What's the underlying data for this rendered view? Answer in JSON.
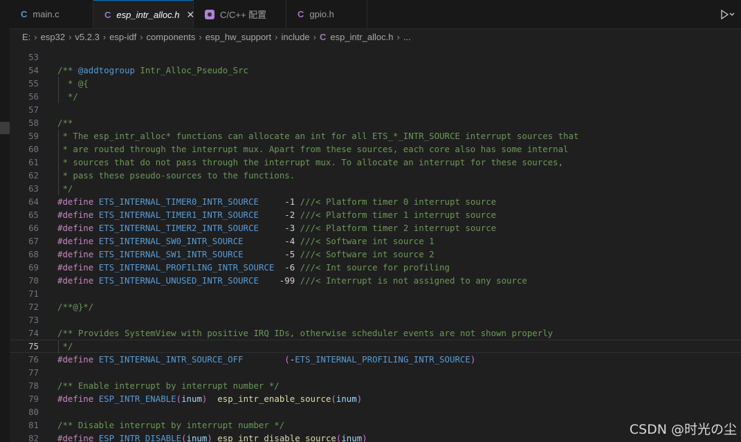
{
  "tabs": [
    {
      "icon": "C",
      "label": "main.c"
    },
    {
      "icon": "C",
      "label": "esp_intr_alloc.h",
      "close": "✕"
    },
    {
      "label": "C/C++ 配置"
    },
    {
      "icon": "C",
      "label": "gpio.h"
    }
  ],
  "breadcrumb": {
    "items": [
      "E:",
      "esp32",
      "v5.2.3",
      "esp-idf",
      "components",
      "esp_hw_support",
      "include"
    ],
    "file_icon": "C",
    "file": "esp_intr_alloc.h",
    "more": "...",
    "separator": "›"
  },
  "editor": {
    "lines": [
      {
        "n": "53",
        "parts": []
      },
      {
        "n": "54",
        "parts": [
          [
            "cm",
            "/** "
          ],
          [
            "tag",
            "@addtogroup"
          ],
          [
            "cm",
            " Intr_Alloc_Pseudo_Src"
          ]
        ]
      },
      {
        "n": "55",
        "parts": [
          [
            "cm",
            "  * @{"
          ]
        ]
      },
      {
        "n": "56",
        "parts": [
          [
            "cm",
            "  */"
          ]
        ]
      },
      {
        "n": "57",
        "parts": []
      },
      {
        "n": "58",
        "parts": [
          [
            "cm",
            "/**"
          ]
        ]
      },
      {
        "n": "59",
        "parts": [
          [
            "cm",
            " * The esp_intr_alloc* functions can allocate an int for all ETS_*_INTR_SOURCE interrupt sources that"
          ]
        ]
      },
      {
        "n": "60",
        "parts": [
          [
            "cm",
            " * are routed through the interrupt mux. Apart from these sources, each core also has some internal"
          ]
        ]
      },
      {
        "n": "61",
        "parts": [
          [
            "cm",
            " * sources that do not pass through the interrupt mux. To allocate an interrupt for these sources,"
          ]
        ]
      },
      {
        "n": "62",
        "parts": [
          [
            "cm",
            " * pass these pseudo-sources to the functions."
          ]
        ]
      },
      {
        "n": "63",
        "parts": [
          [
            "cm",
            " */"
          ]
        ]
      },
      {
        "n": "64",
        "parts": [
          [
            "pp",
            "#define"
          ],
          [
            "pun",
            " "
          ],
          [
            "mac",
            "ETS_INTERNAL_TIMER0_INTR_SOURCE"
          ],
          [
            "pun",
            "     "
          ],
          [
            "num",
            "-1"
          ],
          [
            "pun",
            " "
          ],
          [
            "cm",
            "///< Platform timer 0 interrupt source"
          ]
        ]
      },
      {
        "n": "65",
        "parts": [
          [
            "pp",
            "#define"
          ],
          [
            "pun",
            " "
          ],
          [
            "mac",
            "ETS_INTERNAL_TIMER1_INTR_SOURCE"
          ],
          [
            "pun",
            "     "
          ],
          [
            "num",
            "-2"
          ],
          [
            "pun",
            " "
          ],
          [
            "cm",
            "///< Platform timer 1 interrupt source"
          ]
        ]
      },
      {
        "n": "66",
        "parts": [
          [
            "pp",
            "#define"
          ],
          [
            "pun",
            " "
          ],
          [
            "mac",
            "ETS_INTERNAL_TIMER2_INTR_SOURCE"
          ],
          [
            "pun",
            "     "
          ],
          [
            "num",
            "-3"
          ],
          [
            "pun",
            " "
          ],
          [
            "cm",
            "///< Platform timer 2 interrupt source"
          ]
        ]
      },
      {
        "n": "67",
        "parts": [
          [
            "pp",
            "#define"
          ],
          [
            "pun",
            " "
          ],
          [
            "mac",
            "ETS_INTERNAL_SW0_INTR_SOURCE"
          ],
          [
            "pun",
            "        "
          ],
          [
            "num",
            "-4"
          ],
          [
            "pun",
            " "
          ],
          [
            "cm",
            "///< Software int source 1"
          ]
        ]
      },
      {
        "n": "68",
        "parts": [
          [
            "pp",
            "#define"
          ],
          [
            "pun",
            " "
          ],
          [
            "mac",
            "ETS_INTERNAL_SW1_INTR_SOURCE"
          ],
          [
            "pun",
            "        "
          ],
          [
            "num",
            "-5"
          ],
          [
            "pun",
            " "
          ],
          [
            "cm",
            "///< Software int source 2"
          ]
        ]
      },
      {
        "n": "69",
        "parts": [
          [
            "pp",
            "#define"
          ],
          [
            "pun",
            " "
          ],
          [
            "mac",
            "ETS_INTERNAL_PROFILING_INTR_SOURCE"
          ],
          [
            "pun",
            "  "
          ],
          [
            "num",
            "-6"
          ],
          [
            "pun",
            " "
          ],
          [
            "cm",
            "///< Int source for profiling"
          ]
        ]
      },
      {
        "n": "70",
        "parts": [
          [
            "pp",
            "#define"
          ],
          [
            "pun",
            " "
          ],
          [
            "mac",
            "ETS_INTERNAL_UNUSED_INTR_SOURCE"
          ],
          [
            "pun",
            "    "
          ],
          [
            "num",
            "-99"
          ],
          [
            "pun",
            " "
          ],
          [
            "cm",
            "///< Interrupt is not assigned to any source"
          ]
        ]
      },
      {
        "n": "71",
        "parts": []
      },
      {
        "n": "72",
        "parts": [
          [
            "cm",
            "/**@}*/"
          ]
        ]
      },
      {
        "n": "73",
        "parts": []
      },
      {
        "n": "74",
        "parts": [
          [
            "cm",
            "/** Provides SystemView with positive IRQ IDs, otherwise scheduler events are not shown properly"
          ]
        ]
      },
      {
        "n": "75",
        "parts": [
          [
            "cm",
            " */"
          ]
        ]
      },
      {
        "n": "76",
        "parts": [
          [
            "pp",
            "#define"
          ],
          [
            "pun",
            " "
          ],
          [
            "mac",
            "ETS_INTERNAL_INTR_SOURCE_OFF"
          ],
          [
            "pun",
            "        "
          ],
          [
            "brk",
            "("
          ],
          [
            "pun",
            "-"
          ],
          [
            "mac",
            "ETS_INTERNAL_PROFILING_INTR_SOURCE"
          ],
          [
            "brk",
            ")"
          ]
        ]
      },
      {
        "n": "77",
        "parts": []
      },
      {
        "n": "78",
        "parts": [
          [
            "cm",
            "/** Enable interrupt by interrupt number */"
          ]
        ]
      },
      {
        "n": "79",
        "parts": [
          [
            "pp",
            "#define"
          ],
          [
            "pun",
            " "
          ],
          [
            "mac",
            "ESP_INTR_ENABLE"
          ],
          [
            "brk",
            "("
          ],
          [
            "par",
            "inum"
          ],
          [
            "brk",
            ")"
          ],
          [
            "pun",
            "  "
          ],
          [
            "fn",
            "esp_intr_enable_source"
          ],
          [
            "brk",
            "("
          ],
          [
            "par",
            "inum"
          ],
          [
            "brk",
            ")"
          ]
        ]
      },
      {
        "n": "80",
        "parts": []
      },
      {
        "n": "81",
        "parts": [
          [
            "cm",
            "/** Disable interrupt by interrupt number */"
          ]
        ]
      },
      {
        "n": "82",
        "parts": [
          [
            "pp",
            "#define"
          ],
          [
            "pun",
            " "
          ],
          [
            "mac",
            "ESP_INTR_DISABLE"
          ],
          [
            "brk",
            "("
          ],
          [
            "par",
            "inum"
          ],
          [
            "brk",
            ")"
          ],
          [
            "pun",
            " "
          ],
          [
            "fn",
            "esp_intr_disable_source"
          ],
          [
            "brk",
            "("
          ],
          [
            "par",
            "inum"
          ],
          [
            "brk",
            ")"
          ]
        ]
      }
    ]
  },
  "watermark": "CSDN @时光の尘"
}
